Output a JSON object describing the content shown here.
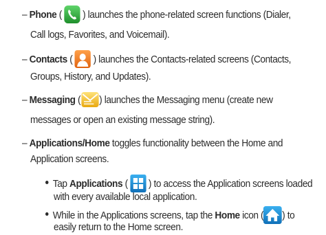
{
  "items": [
    {
      "dash": "–",
      "term": "Phone",
      "open_paren": " ( ",
      "close_paren": " ) ",
      "icon": "phone-icon",
      "text_after_icon": "launches the phone-related screen functions (Dialer,",
      "line2": "Call logs, Favorites, and Voicemail)."
    },
    {
      "dash": "–",
      "term": "Contacts",
      "open_paren": " ( ",
      "close_paren": " ) ",
      "icon": "contacts-icon",
      "text_after_icon": "launches the Contacts-related screens (Contacts,",
      "line2": "Groups, History, and Updates)."
    },
    {
      "dash": "–",
      "term": "Messaging",
      "open_paren": " (",
      "close_paren": ") ",
      "icon": "messaging-icon",
      "text_after_icon": "launches the Messaging menu (create new",
      "line2": "messages or open an existing message string)."
    },
    {
      "dash": "–",
      "term": "Applications/Home",
      "text_after_term": " toggles functionality between the Home and",
      "line2": "Application screens."
    }
  ],
  "sub_items": [
    {
      "lead": "Tap ",
      "term": "Applications",
      "open_paren": " ( ",
      "close_paren": " ) ",
      "icon": "applications-grid-icon",
      "text_after_icon": "to access the Application screens loaded",
      "line2": "with every available local application."
    },
    {
      "lead": "While in the Applications screens, tap the ",
      "term": "Home",
      "text_before_icon": " icon (",
      "close_paren": ") ",
      "icon": "home-icon",
      "text_after_icon": "to",
      "line2": "easily return to the Home screen."
    }
  ],
  "colors": {
    "text": "#2b2b2b",
    "phone_icon": "#2eaa3a",
    "contacts_icon": "#f07c1c",
    "messaging_icon": "#f0c419",
    "applications_icon": "#1b8fd6",
    "home_icon": "#1b8fd6"
  }
}
